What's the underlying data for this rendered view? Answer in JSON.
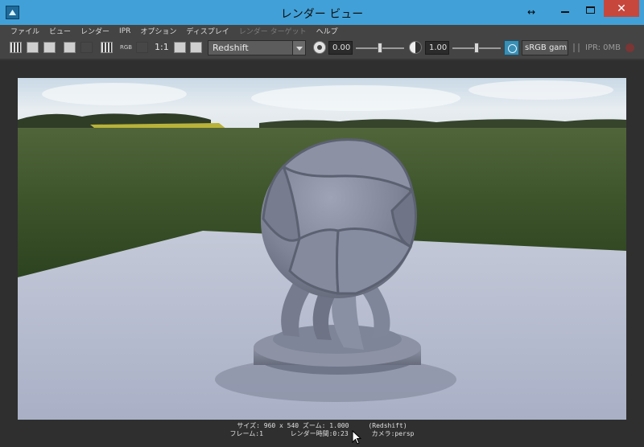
{
  "window": {
    "title": "レンダー ビュー",
    "close_glyph": "✕",
    "resize_glyph": "↔"
  },
  "menu": [
    {
      "label": "ファイル",
      "enabled": true
    },
    {
      "label": "ビュー",
      "enabled": true
    },
    {
      "label": "レンダー",
      "enabled": true
    },
    {
      "label": "IPR",
      "enabled": true
    },
    {
      "label": "オプション",
      "enabled": true
    },
    {
      "label": "ディスプレイ",
      "enabled": true
    },
    {
      "label": "レンダー ターゲット",
      "enabled": false
    },
    {
      "label": "ヘルプ",
      "enabled": true
    }
  ],
  "toolbar": {
    "rgb_label": "RGB",
    "ratio_label": "1:1",
    "renderer": "Redshift",
    "exposure_value": "0.00",
    "exposure_slider": 0.5,
    "gamma_value": "1.00",
    "gamma_slider": 0.5,
    "color_space": "sRGB gamma",
    "ipr_memory": "IPR: 0MB"
  },
  "status": {
    "line1": "サイズ: 960 x 540 ズーム: 1.000     (Redshift)",
    "line2": "フレーム:1       レンダー時間:0:23      カメラ:persp"
  },
  "colors": {
    "title_bar": "#41a0d8",
    "close_button": "#c7473d",
    "menu_bg": "#444444",
    "viewport_bg": "#2f2f2f",
    "accent": "#3a8fb5"
  }
}
